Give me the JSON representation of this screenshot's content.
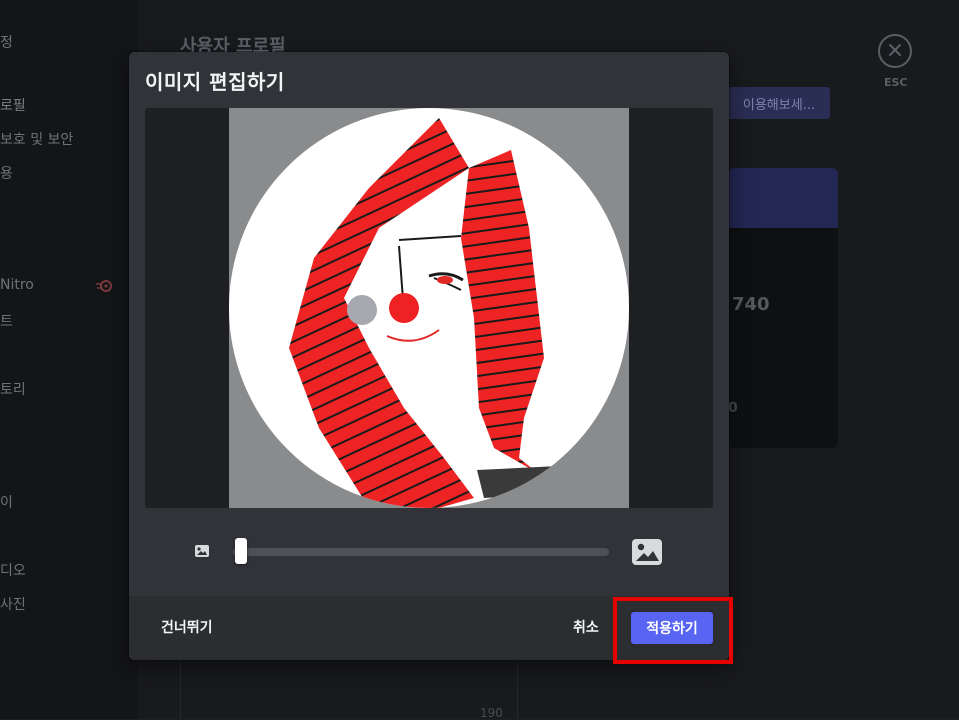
{
  "background": {
    "page_title": "사용자 프로필",
    "sidebar_items": [
      "정",
      "로필",
      "보호 및 보안",
      "용",
      "Nitro",
      "트",
      "토리",
      "이",
      "디오",
      "사진"
    ],
    "header_button_label": "이용해보세...",
    "card_number": "740",
    "card_number_2": "0",
    "bottom_number": "190",
    "esc_label": "ESC"
  },
  "modal": {
    "title": "이미지 편집하기",
    "zoom_level": 0.0,
    "footer": {
      "skip_label": "건너뛰기",
      "cancel_label": "취소",
      "apply_label": "적용하기"
    }
  },
  "colors": {
    "accent": "#5865f2",
    "highlight": "#e60000",
    "modal_bg": "#313338",
    "footer_bg": "#2b2d31"
  },
  "icons": {
    "zoom_out": "image-small-icon",
    "zoom_in": "image-large-icon",
    "close": "close-icon"
  }
}
